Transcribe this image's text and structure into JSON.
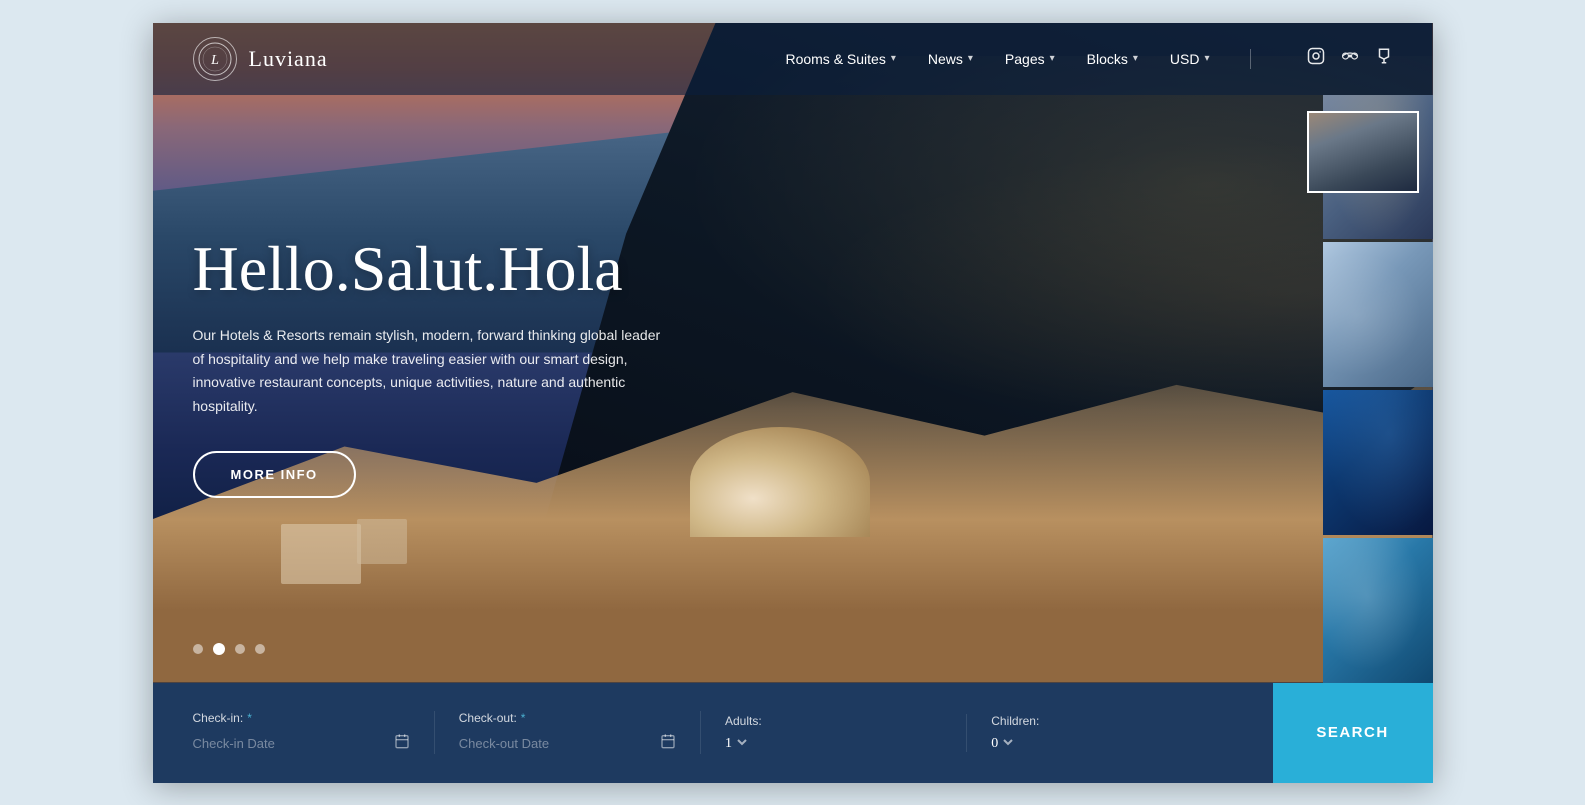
{
  "brand": {
    "logo_letter": "L",
    "name": "Luviana"
  },
  "nav": {
    "items": [
      {
        "id": "rooms",
        "label": "Rooms & Suites",
        "has_dropdown": true
      },
      {
        "id": "news",
        "label": "News",
        "has_dropdown": true
      },
      {
        "id": "pages",
        "label": "Pages",
        "has_dropdown": true
      },
      {
        "id": "blocks",
        "label": "Blocks",
        "has_dropdown": true
      },
      {
        "id": "currency",
        "label": "USD",
        "has_dropdown": true
      }
    ],
    "social": [
      {
        "id": "instagram",
        "icon": "📷"
      },
      {
        "id": "tripadvisor",
        "icon": "✈"
      },
      {
        "id": "foursquare",
        "icon": "⚑"
      }
    ]
  },
  "hero": {
    "title": "Hello.Salut.Hola",
    "description": "Our Hotels & Resorts remain stylish, modern, forward thinking global leader of hospitality and we help make traveling easier with our smart design, innovative restaurant concepts, unique activities, nature and authentic hospitality.",
    "cta_label": "MORE INFO",
    "dots": [
      {
        "id": 1,
        "active": false
      },
      {
        "id": 2,
        "active": true
      },
      {
        "id": 3,
        "active": false
      },
      {
        "id": 4,
        "active": false
      }
    ]
  },
  "booking": {
    "checkin": {
      "label": "Check-in:",
      "required": true,
      "placeholder": "Check-in Date"
    },
    "checkout": {
      "label": "Check-out:",
      "required": true,
      "placeholder": "Check-out Date"
    },
    "adults": {
      "label": "Adults:",
      "value": "1"
    },
    "children": {
      "label": "Children:",
      "value": "0"
    },
    "search_label": "SEARCH"
  },
  "colors": {
    "accent": "#29afd8",
    "nav_bg": "rgba(10,30,60,0.6)",
    "booking_bg": "#1e3a60"
  }
}
